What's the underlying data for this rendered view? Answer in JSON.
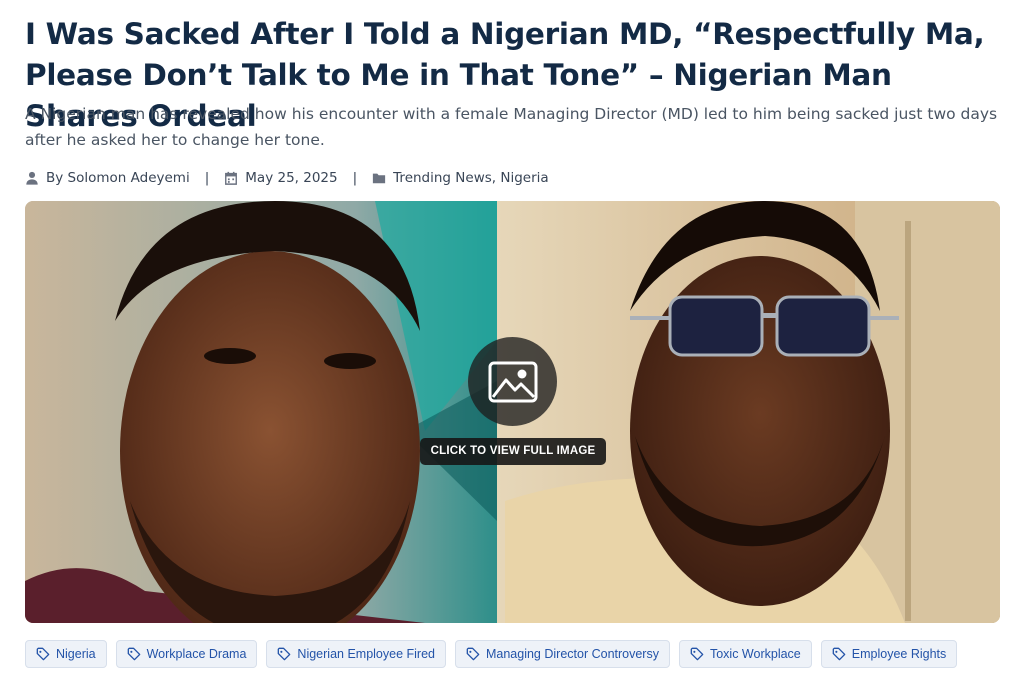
{
  "article": {
    "title": "I Was Sacked After I Told a Nigerian MD, “Respectfully Ma, Please Don’t Talk to Me in That Tone” – Nigerian Man Shares Ordeal",
    "excerpt": "A Nigerian man has revealed how his encounter with a female Managing Director (MD) led to him being sacked just two days after he asked her to change her tone.",
    "meta": {
      "author": "By Solomon Adeyemi",
      "author_icon": "user-icon",
      "date": "May 25, 2025",
      "date_icon": "calendar-icon",
      "categories": "Trending News, Nigeria",
      "categories_icon": "folder-icon",
      "separator": "|"
    },
    "image": {
      "view_label": "CLICK TO VIEW FULL IMAGE",
      "icon": "image-icon"
    },
    "tags": [
      "Nigeria",
      "Workplace Drama",
      "Nigerian Employee Fired",
      "Managing Director Controversy",
      "Toxic Workplace",
      "Employee Rights"
    ],
    "tag_icon": "tag-icon"
  },
  "colors": {
    "title": "#132a45",
    "tag_text": "#2353a8",
    "tag_bg": "#eef2f8"
  }
}
